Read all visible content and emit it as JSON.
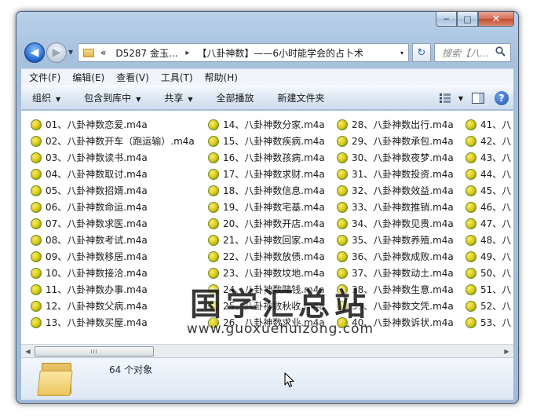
{
  "window": {
    "caption_minimize": "─",
    "caption_maximize": "□",
    "caption_close": "✕"
  },
  "nav": {
    "back_glyph": "◀",
    "forward_glyph": "▶",
    "dropdown_glyph": "▼"
  },
  "address": {
    "prefix": "«",
    "crumb_1": "D5287 金玉...",
    "separator": "▸",
    "crumb_2": "【八卦神数】——6小时能学会的占卜术",
    "dropdown_glyph": "▾"
  },
  "refresh_glyph": "↻",
  "search": {
    "placeholder": "搜索【八...",
    "icon": "search-icon"
  },
  "menu": [
    "文件(F)",
    "编辑(E)",
    "查看(V)",
    "工具(T)",
    "帮助(H)"
  ],
  "toolbar": {
    "organize": "组织",
    "include_library": "包含到库中",
    "share": "共享",
    "play_all": "全部播放",
    "new_folder": "新建文件夹",
    "arrow": "▼",
    "help": "?"
  },
  "files": {
    "columns": [
      [
        "01、八卦神数恋爱.m4a",
        "02、八卦神数开车（跑运输）.m4a",
        "03、八卦神数读书.m4a",
        "04、八卦神数取讨.m4a",
        "05、八卦神数招婿.m4a",
        "06、八卦神数命运.m4a",
        "07、八卦神数求医.m4a",
        "08、八卦神数考试.m4a",
        "09、八卦神数移居.m4a",
        "10、八卦神数接洽.m4a",
        "11、八卦神数办事.m4a",
        "12、八卦神数父病.m4a",
        "13、八卦神数买屋.m4a"
      ],
      [
        "14、八卦神数分家.m4a",
        "15、八卦神数疾病.m4a",
        "16、八卦神数孩病.m4a",
        "17、八卦神数求财.m4a",
        "18、八卦神数信息.m4a",
        "19、八卦神数宅基.m4a",
        "20、八卦神数开店.m4a",
        "21、八卦神数回家.m4a",
        "22、八卦神数放债.m4a",
        "23、八卦神数坟地.m4a",
        "24、八卦神数赌钱.m4a",
        "25、八卦神数秋收.m4a",
        "26、八卦神数求业.m4a"
      ],
      [
        "28、八卦神数出行.m4a",
        "29、八卦神数承包.m4a",
        "30、八卦神数夜梦.m4a",
        "31、八卦神数投资.m4a",
        "32、八卦神数效益.m4a",
        "33、八卦神数推销.m4a",
        "34、八卦神数见贵.m4a",
        "35、八卦神数养殖.m4a",
        "36、八卦神数成败.m4a",
        "37、八卦神数动土.m4a",
        "38、八卦神数生意.m4a",
        "39、八卦神数文凭.m4a",
        "40、八卦神数诉状.m4a"
      ],
      [
        "41、八",
        "42、八",
        "43、八",
        "44、八",
        "45、八",
        "46、八",
        "47、八",
        "48、八",
        "49、八",
        "50、八",
        "51、八",
        "52、八",
        "53、八"
      ]
    ]
  },
  "watermark": {
    "main": "国学汇总站",
    "url": "www.guoxuehuizong.com"
  },
  "scrollbar": {
    "left_arrow": "◀",
    "right_arrow": "▶",
    "grip": "III"
  },
  "details": {
    "count": "64 个对象"
  }
}
